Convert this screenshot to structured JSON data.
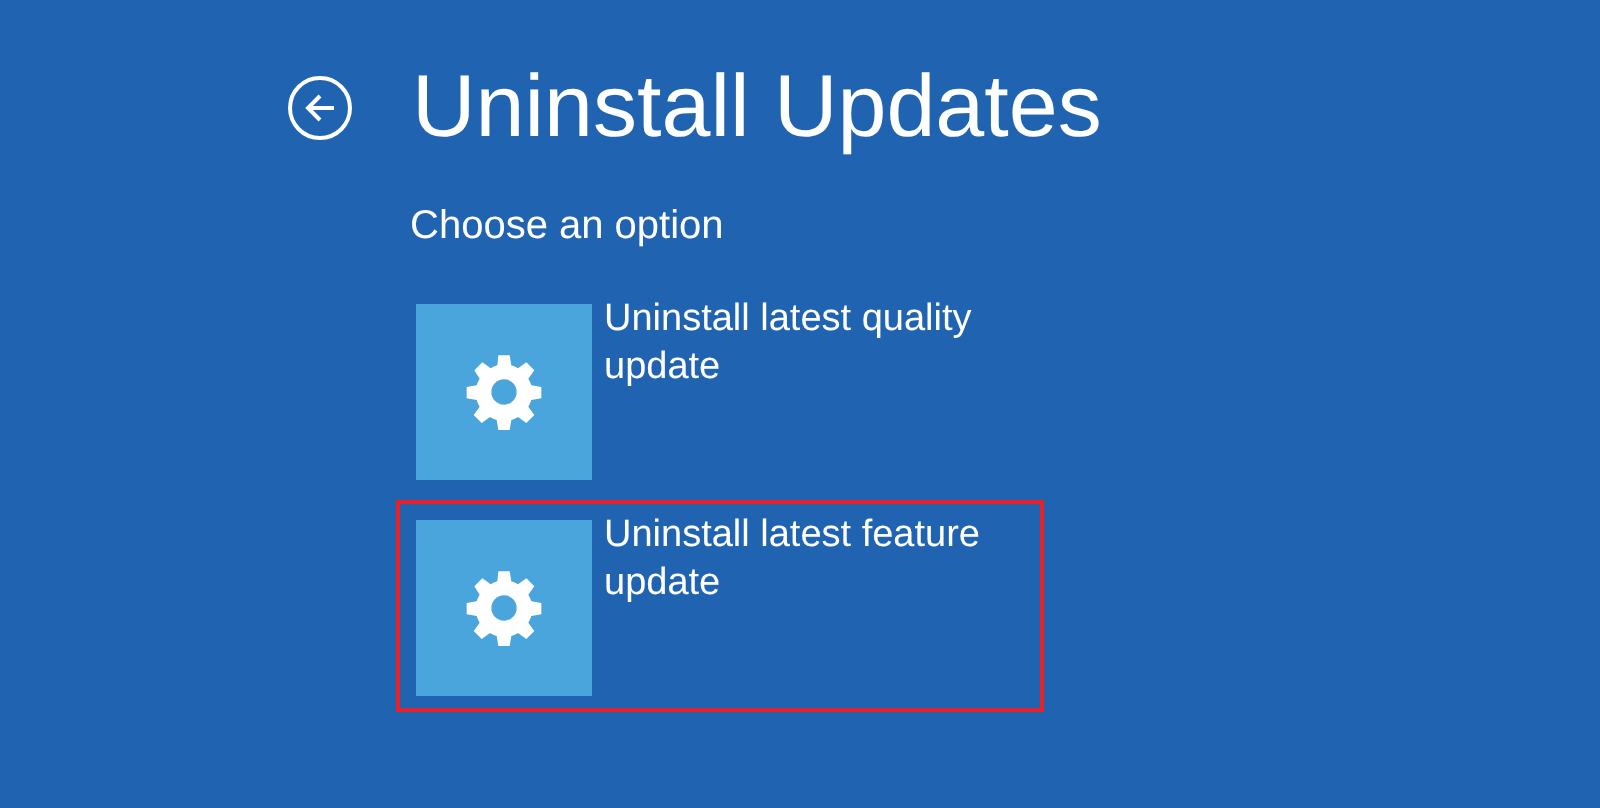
{
  "header": {
    "title": "Uninstall Updates"
  },
  "subtitle": "Choose an option",
  "options": [
    {
      "label": "Uninstall latest quality update",
      "highlighted": false
    },
    {
      "label": "Uninstall latest feature update",
      "highlighted": true
    }
  ]
}
